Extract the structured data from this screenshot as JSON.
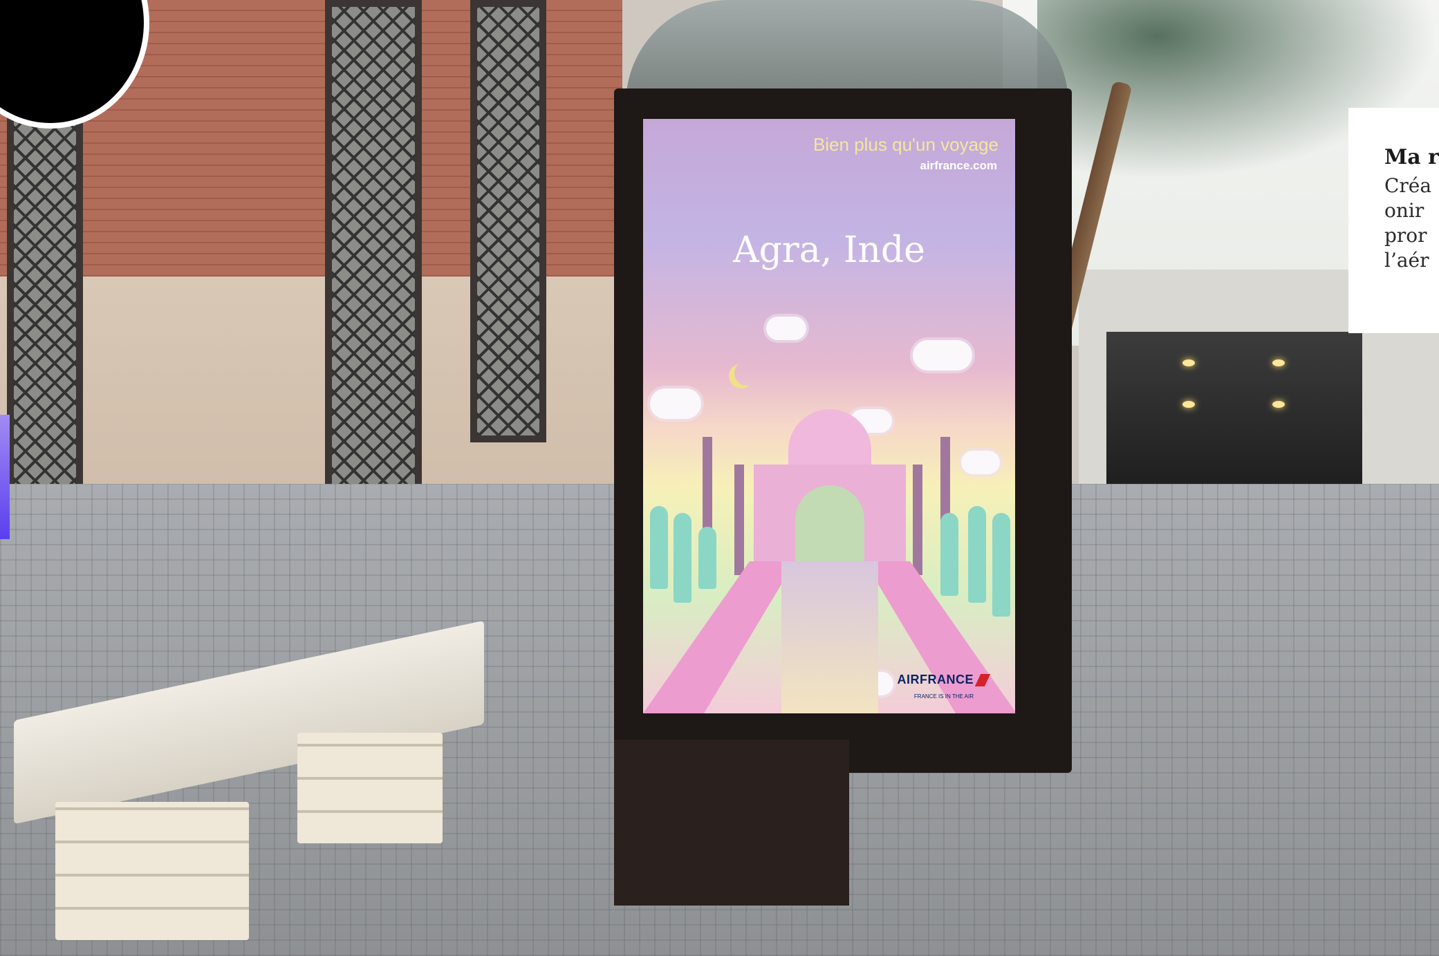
{
  "poster": {
    "tagline": "Bien plus qu'un voyage",
    "url": "airfrance.com",
    "title": "Agra, Inde",
    "brand": "AIRFRANCE",
    "subbrand": "FRANCE IS IN THE AIR"
  },
  "card": {
    "title": "Ma r",
    "lines": [
      "Créa",
      "onir",
      "pror",
      "l’aér"
    ]
  },
  "colors": {
    "poster_tagline": "#f6e79a",
    "brand_blue": "#0b2465",
    "brand_red": "#d3222a"
  }
}
